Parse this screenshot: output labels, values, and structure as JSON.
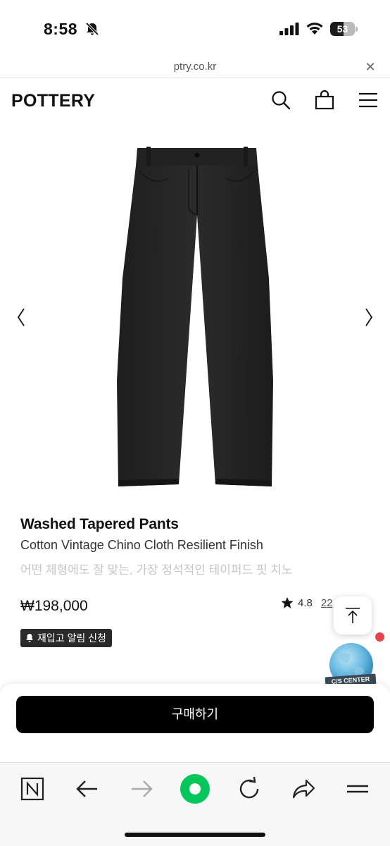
{
  "status_bar": {
    "time": "8:58",
    "battery_level": "53",
    "battery_percent": 53
  },
  "browser": {
    "url": "ptry.co.kr",
    "close_glyph": "✕"
  },
  "header": {
    "logo": "POTTERY",
    "icons": [
      "search-icon",
      "shopping-bag-icon",
      "menu-icon"
    ]
  },
  "gallery": {
    "prev_icon": "chevron-left-icon",
    "next_icon": "chevron-right-icon"
  },
  "product": {
    "name": "Washed Tapered Pants",
    "subtitle": "Cotton Vintage Chino Cloth Resilient Finish",
    "description": "어떤 체형에도 잘 맞는, 가장 정석적인 테이퍼드 핏 치노",
    "price": "₩198,000",
    "rating": "4.8",
    "review_count": "22",
    "restock_label": "재입고 알림 신청"
  },
  "floating": {
    "cs_label": "C/S CENTER"
  },
  "purchase": {
    "buy_label": "구매하기"
  },
  "bottom_bar": {
    "icons": [
      "naver-n-icon",
      "back-arrow-icon",
      "forward-arrow-icon",
      "green-dot-icon",
      "reload-icon",
      "share-icon",
      "menu-icon"
    ]
  },
  "colors": {
    "brand_green": "#03c75a",
    "buy_button": "#000000",
    "badge_bg": "#2a2a2a",
    "notification_red": "#e8434d"
  }
}
